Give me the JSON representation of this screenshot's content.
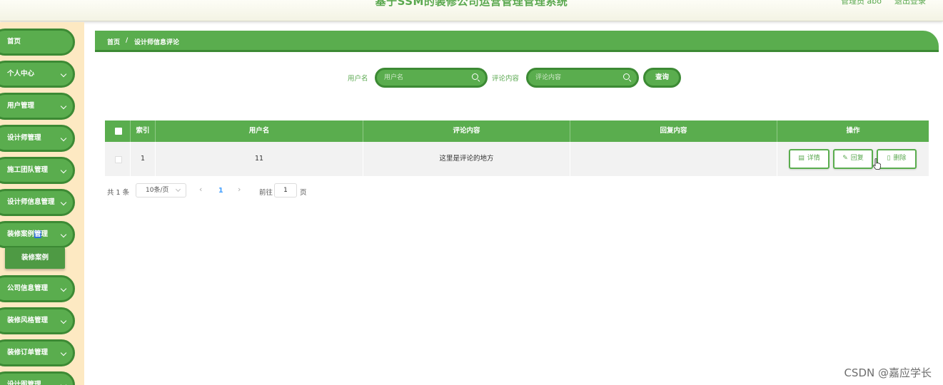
{
  "header": {
    "title": "基于SSM的装修公司运营管理管理系统",
    "admin": "管理员 abo",
    "logout": "退出登录"
  },
  "sidebar": {
    "items": [
      {
        "label": "首页"
      },
      {
        "label": "个人中心"
      },
      {
        "label": "用户管理"
      },
      {
        "label": "设计师管理"
      },
      {
        "label": "施工团队管理"
      },
      {
        "label": "设计师信息管理"
      },
      {
        "label_before": "装修案例",
        "label_highlight": "管",
        "label_after": "理"
      },
      {
        "label": "公司信息管理"
      },
      {
        "label": "装修风格管理"
      },
      {
        "label": "装修订单管理"
      },
      {
        "label": "设计图管理"
      }
    ],
    "submenu": {
      "label": "装修案例"
    },
    "colors": {
      "bg": "#fde9c2",
      "item": "#5aad4e",
      "item_border": "#3c8a34"
    }
  },
  "breadcrumb": {
    "home": "首页",
    "separator": "/",
    "current": "设计师信息评论"
  },
  "search": {
    "username_label": "用户名",
    "username_placeholder": "用户名",
    "comment_label": "评论内容",
    "comment_placeholder": "评论内容",
    "query_button": "查询"
  },
  "table": {
    "headers": [
      "索引",
      "用户名",
      "评论内容",
      "回复内容",
      "操作"
    ],
    "rows": [
      {
        "index": "1",
        "username": "11",
        "comment": "这里是评论的地方",
        "reply": ""
      }
    ],
    "actions": {
      "detail": "详情",
      "reply": "回复",
      "delete": "删除"
    }
  },
  "pagination": {
    "total": "共 1 条",
    "page_size": "10条/页",
    "prev": "‹",
    "current": "1",
    "next": "›",
    "goto_label": "前往",
    "goto_value": "1",
    "page_suffix": "页"
  },
  "watermark": "CSDN @嘉应学长",
  "icons": {
    "search": "search-icon",
    "chevron": "chevron-down-icon",
    "detail": "document-icon",
    "reply": "edit-icon",
    "delete": "trash-icon"
  }
}
